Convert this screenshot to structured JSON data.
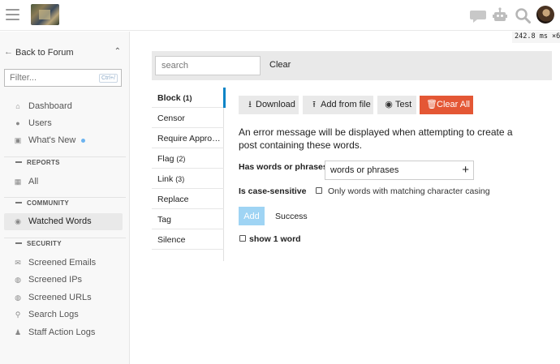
{
  "header": {
    "icons": [
      "hamburger-icon",
      "site-logo",
      "chat-icon",
      "robot-icon",
      "search-icon",
      "avatar"
    ],
    "timing": "242.8 ms ×6"
  },
  "sidebar": {
    "back_label": "Back to Forum",
    "filter_placeholder": "Filter...",
    "filter_shortcut": "Ctrl+/",
    "items": [
      {
        "label": "Dashboard",
        "icon": "home-icon"
      },
      {
        "label": "Users",
        "icon": "users-icon"
      },
      {
        "label": "What's New",
        "icon": "gift-icon"
      }
    ],
    "sections": [
      {
        "label": "REPORTS",
        "items": [
          {
            "label": "All",
            "icon": "chart-icon"
          }
        ]
      },
      {
        "label": "COMMUNITY",
        "items": [
          {
            "label": "Watched Words",
            "icon": "eye-icon"
          }
        ]
      },
      {
        "label": "SECURITY",
        "items": [
          {
            "label": "Screened Emails",
            "icon": "envelope-icon"
          },
          {
            "label": "Screened IPs",
            "icon": "globe-icon"
          },
          {
            "label": "Screened URLs",
            "icon": "globe-icon"
          },
          {
            "label": "Search Logs",
            "icon": "search-icon"
          },
          {
            "label": "Staff Action Logs",
            "icon": "user-shield-icon"
          }
        ]
      }
    ]
  },
  "search": {
    "placeholder": "search",
    "clear_label": "Clear"
  },
  "tabs": [
    {
      "label": "Block",
      "count": "(1)"
    },
    {
      "label": "Censor",
      "count": ""
    },
    {
      "label": "Require Appro…",
      "count": ""
    },
    {
      "label": "Flag",
      "count": "(2)"
    },
    {
      "label": "Link",
      "count": "(3)"
    },
    {
      "label": "Replace",
      "count": ""
    },
    {
      "label": "Tag",
      "count": ""
    },
    {
      "label": "Silence",
      "count": ""
    }
  ],
  "toolbar": {
    "download_label": "Download",
    "add_from_file_label": "Add from file",
    "test_label": "Test",
    "clear_all_label": "Clear All"
  },
  "main": {
    "description": "An error message will be displayed when attempting to create a post containing these words.",
    "words_label": "Has words or phrases",
    "words_value": "words or phrases",
    "case_label": "Is case-sensitive",
    "case_option": "Only words with matching character casing",
    "add_label": "Add",
    "success_text": "Success",
    "show_label": "show 1 word"
  },
  "colors": {
    "accent": "#0a84c6",
    "danger": "#e45735",
    "add_disabled": "#9fd4f4",
    "active_dot": "#6cb3ef"
  }
}
